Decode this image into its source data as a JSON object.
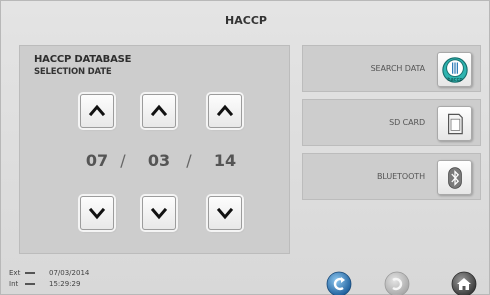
{
  "header": {
    "title": "HACCP"
  },
  "panel": {
    "title": "HACCP DATABASE",
    "subtitle": "SELECTION DATE",
    "date": {
      "day": "07",
      "month": "03",
      "year": "14",
      "separator": "/"
    }
  },
  "actions": [
    {
      "label": "SEARCH DATA",
      "icon": "haccp-icon",
      "icon_text": "haccp"
    },
    {
      "label": "SD CARD",
      "icon": "sd-card-icon"
    },
    {
      "label": "BLUETOOTH",
      "icon": "bluetooth-icon"
    }
  ],
  "status": {
    "ext_label": "Ext",
    "ext_value": "07/03/2014",
    "int_label": "Int",
    "int_value": "15:29:29"
  },
  "colors": {
    "background": "#dcdcdc",
    "panel": "#cdcdcd",
    "accent_blue": "#2a7fc1",
    "haccp_teal": "#1d9a97"
  }
}
